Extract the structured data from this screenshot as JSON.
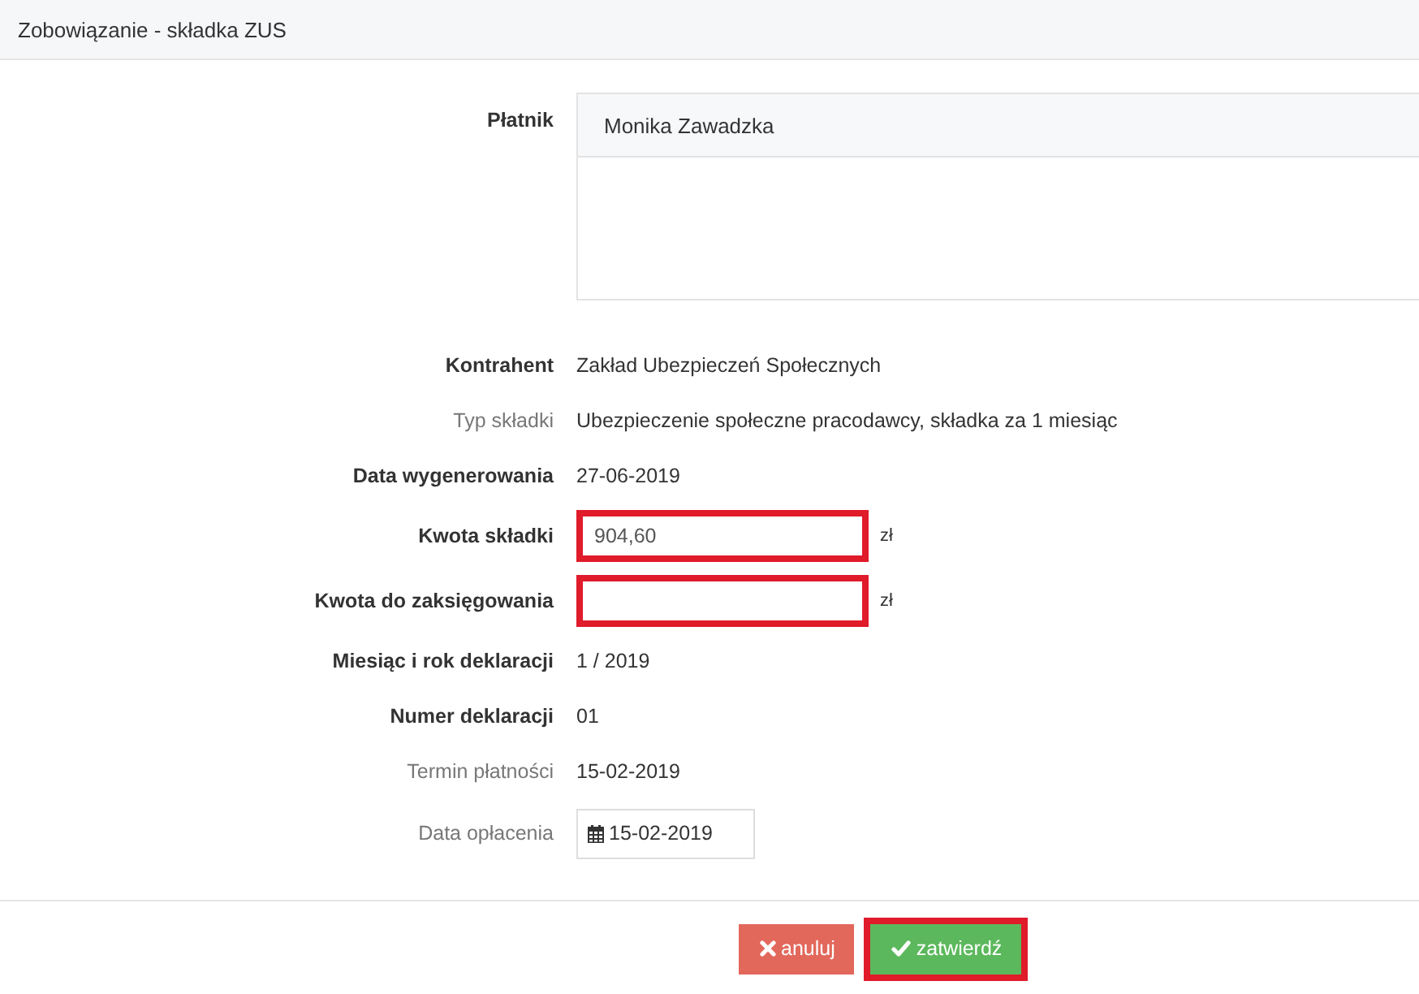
{
  "window": {
    "title": "Zobowiązanie - składka ZUS"
  },
  "payer": {
    "label": "Płatnik",
    "name": "Monika Zawadzka"
  },
  "fields": [
    {
      "kind": "text",
      "label": "Kontrahent",
      "bold": true,
      "value": "Zakład Ubezpieczeń Społecznych"
    },
    {
      "kind": "text",
      "label": "Typ składki",
      "bold": false,
      "value": "Ubezpieczenie społeczne pracodawcy, składka za 1 miesiąc"
    },
    {
      "kind": "text",
      "label": "Data wygenerowania",
      "bold": true,
      "value": "27-06-2019"
    },
    {
      "kind": "input",
      "label": "Kwota składki",
      "bold": true,
      "value": "904,60",
      "unit": "zł",
      "highlighted": true
    },
    {
      "kind": "input",
      "label": "Kwota do zaksięgowania",
      "bold": true,
      "unit": "zł",
      "highlighted": true
    },
    {
      "kind": "text",
      "label": "Miesiąc i rok deklaracji",
      "bold": true,
      "value": "1 / 2019"
    },
    {
      "kind": "text",
      "label": "Numer deklaracji",
      "bold": true,
      "value": "01"
    },
    {
      "kind": "text",
      "label": "Termin płatności",
      "bold": false,
      "value": "15-02-2019"
    },
    {
      "kind": "date",
      "label": "Data opłacenia",
      "bold": false,
      "value": "15-02-2019"
    }
  ],
  "buttons": [
    {
      "kind": "cancel",
      "label": "anuluj",
      "highlighted": false
    },
    {
      "kind": "confirm",
      "label": "zatwierdź",
      "highlighted": true
    }
  ]
}
